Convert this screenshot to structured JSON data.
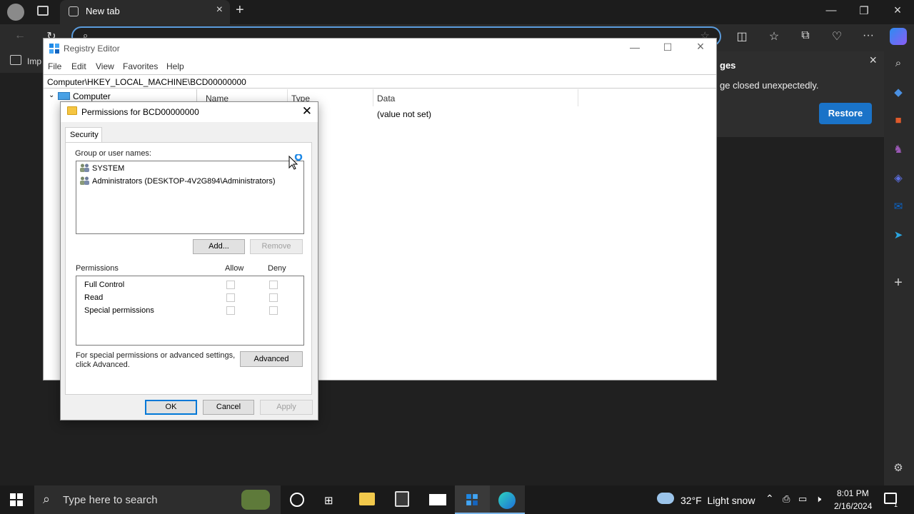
{
  "browser": {
    "tab_title": "New tab",
    "favorites_text": "Imp",
    "restore_panel": {
      "title": "ges",
      "message": "ge closed unexpectedly.",
      "button": "Restore"
    }
  },
  "registry": {
    "title": "Registry Editor",
    "menu": [
      "File",
      "Edit",
      "View",
      "Favorites",
      "Help"
    ],
    "path": "Computer\\HKEY_LOCAL_MACHINE\\BCD00000000",
    "tree_root": "Computer",
    "columns": [
      "Name",
      "Type",
      "Data"
    ],
    "row_data": "(value not set)"
  },
  "dialog": {
    "title": "Permissions for BCD00000000",
    "tab": "Security",
    "group_label": "Group or user names:",
    "users": [
      "SYSTEM",
      "Administrators (DESKTOP-4V2G894\\Administrators)"
    ],
    "add_button": "Add...",
    "remove_button": "Remove",
    "permissions_label": "Permissions",
    "allow_label": "Allow",
    "deny_label": "Deny",
    "permissions": [
      "Full Control",
      "Read",
      "Special permissions"
    ],
    "advanced_note_1": "For special permissions or advanced settings,",
    "advanced_note_2": "click Advanced.",
    "advanced_button": "Advanced",
    "ok_button": "OK",
    "cancel_button": "Cancel",
    "apply_button": "Apply"
  },
  "taskbar": {
    "search_placeholder": "Type here to search",
    "weather": "32°F  Light snow",
    "time": "8:01 PM",
    "date": "2/16/2024",
    "notification_count": "1"
  },
  "colors": {
    "accent": "#0078d7",
    "restore_button": "#1a73c8",
    "taskbar": "#1a1a1a"
  }
}
